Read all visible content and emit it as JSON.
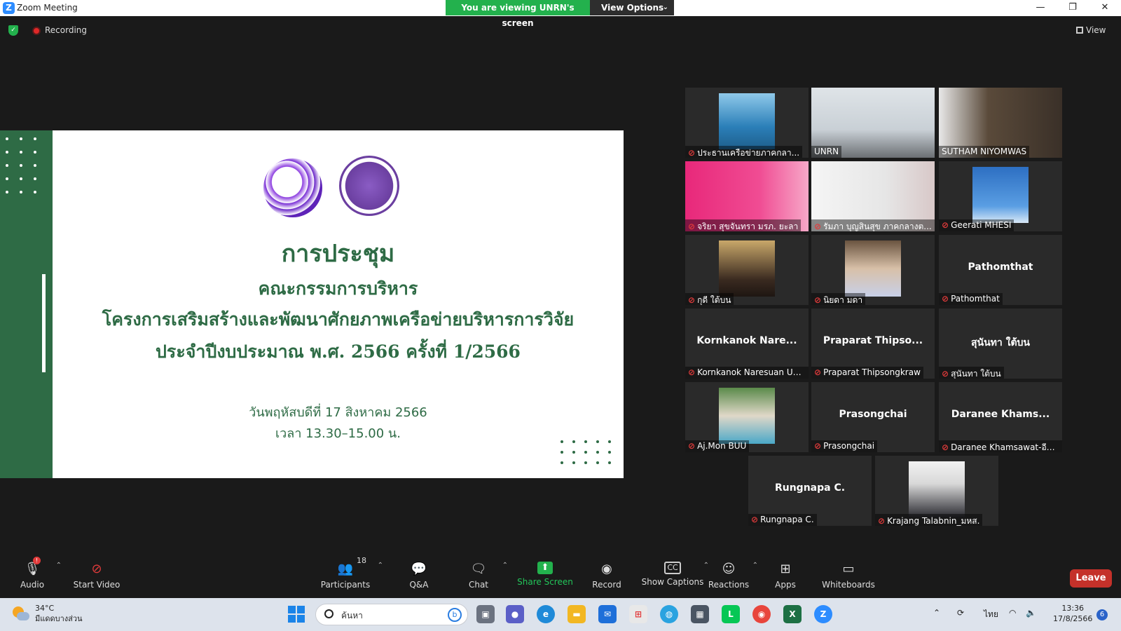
{
  "window": {
    "title": "Zoom Meeting",
    "app_icon": "Z",
    "minimize": "—",
    "maximize": "❐",
    "close": "✕"
  },
  "share_banner": {
    "viewing": "You are viewing UNRN's screen",
    "options": "View Options"
  },
  "meeting_status": {
    "recording": "Recording",
    "view": "View"
  },
  "slide": {
    "title_main": "การประชุม",
    "title_sub1": "คณะกรรมการบริหาร",
    "title_sub2": "โครงการเสริมสร้างและพัฒนาศักยภาพเครือข่ายบริหารการวิจัย",
    "title_sub3": "ประจำปีงบประมาณ พ.ศ. 2566 ครั้งที่ 1/2566",
    "date_line": "วันพฤหัสบดีที่ 17 สิงหาคม 2566",
    "time_line": "เวลา 13.30–15.00 น."
  },
  "participants_gallery": [
    {
      "label": "ประธานเครือข่ายภาคกลา...",
      "pinned": true,
      "video": "small",
      "active": false
    },
    {
      "label": "UNRN",
      "video": "full",
      "active": true
    },
    {
      "label": "SUTHAM NIYOMWAS",
      "video": "full",
      "active": false
    },
    {
      "label": "จริยา สุขจันทรา มรภ. ยะลา",
      "video": "full",
      "active": false
    },
    {
      "label": "รัมภา บุญสินสุข ภาคกลางต...",
      "video": "full",
      "active": false
    },
    {
      "label": "Geerati MHESI",
      "video": "small",
      "active": false
    },
    {
      "label": "กุดี ใต้บน",
      "video": "small",
      "active": false
    },
    {
      "label": "นิยดา มดา",
      "video": "small",
      "active": false
    },
    {
      "label": "Pathomthat",
      "name": "Pathomthat",
      "video": "none",
      "active": false
    },
    {
      "label": "Kornkanok Naresuan Un...",
      "name": "Kornkanok  Nare...",
      "video": "none",
      "active": false
    },
    {
      "label": "Praparat Thipsongkraw",
      "name": "Praparat  Thipso...",
      "video": "none",
      "active": false
    },
    {
      "label": "สุนันทา  ใต้บน",
      "name": "สุนันทา  ใต้บน",
      "video": "none",
      "active": false
    },
    {
      "label": "Aj.Mon BUU",
      "video": "small",
      "active": false
    },
    {
      "label": "Prasongchai",
      "name": "Prasongchai",
      "video": "none",
      "active": false
    },
    {
      "label": "Daranee Khamsawat-อีส...",
      "name": "Daranee  Khams...",
      "video": "none",
      "active": false
    },
    {
      "label": "Rungnapa C.",
      "name": "Rungnapa C.",
      "video": "none",
      "active": false
    },
    {
      "label": "Krajang Talabnin_มหส.",
      "video": "small",
      "active": false
    }
  ],
  "toolbar": {
    "audio": "Audio",
    "start_video": "Start Video",
    "participants": "Participants",
    "participant_count": "18",
    "qa": "Q&A",
    "chat": "Chat",
    "share_screen": "Share Screen",
    "record": "Record",
    "show_captions": "Show Captions",
    "reactions": "Reactions",
    "apps": "Apps",
    "whiteboards": "Whiteboards",
    "leave": "Leave",
    "audio_alert": "!"
  },
  "taskbar": {
    "weather_temp": "34°C",
    "weather_desc": "มีแดดบางส่วน",
    "search_placeholder": "ค้นหา",
    "language": "ไทย",
    "time": "13:36",
    "date": "17/8/2566",
    "notifications": "6"
  },
  "colors": {
    "accent_green": "#23b14d",
    "slide_green": "#2e6b45",
    "leave_red": "#c4312a",
    "active_speaker": "#c8e03a"
  }
}
